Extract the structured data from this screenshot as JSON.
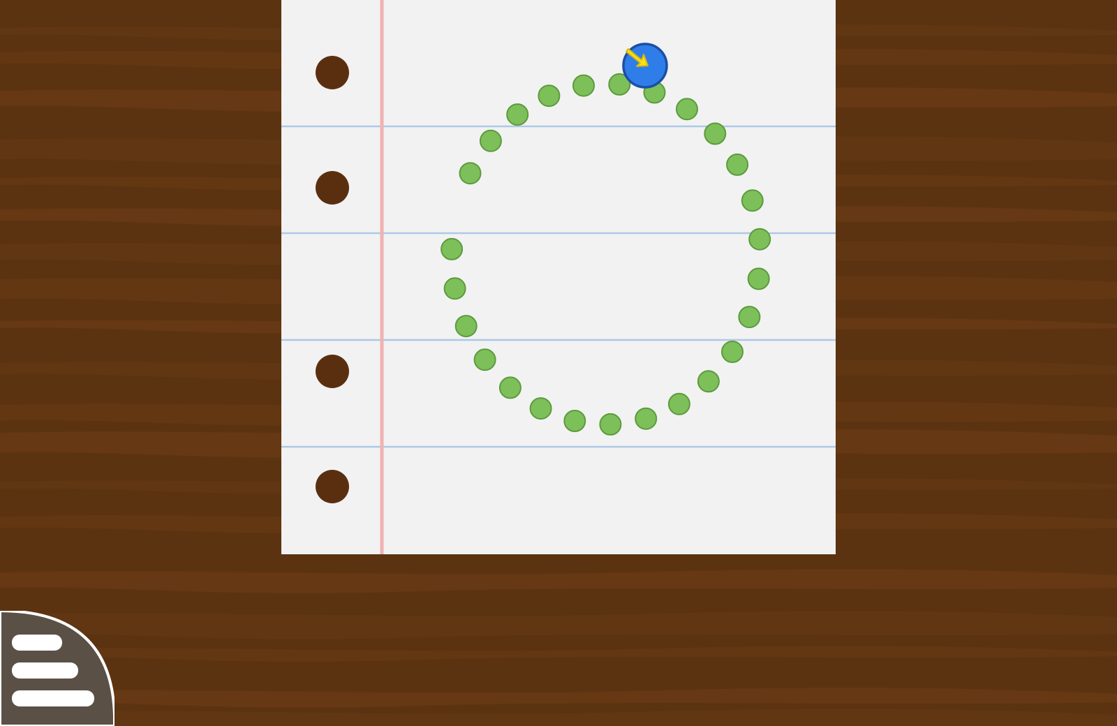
{
  "game": {
    "type": "trace-the-dots",
    "shape": "circle",
    "total_dots": 27,
    "start_dot_index": 0,
    "trace_direction": "clockwise"
  },
  "colors": {
    "desk": "#5c3311",
    "desk_grain": "#6b3c16",
    "paper": "#f2f2f2",
    "rule_line": "#aec8e6",
    "margin_line": "#f0b2b2",
    "punch_hole": "#5a2f10",
    "dot_fill": "#7dc05a",
    "dot_stroke": "#5c9a3e",
    "start_dot_fill": "#2f7de8",
    "start_dot_stroke": "#1b4fa6",
    "arrow": "#f7e21a",
    "menu_bg": "#5a5046",
    "menu_bars": "#ffffff"
  },
  "icons": {
    "menu": "hamburger-menu-icon",
    "start_arrow": "start-arrow-icon"
  }
}
